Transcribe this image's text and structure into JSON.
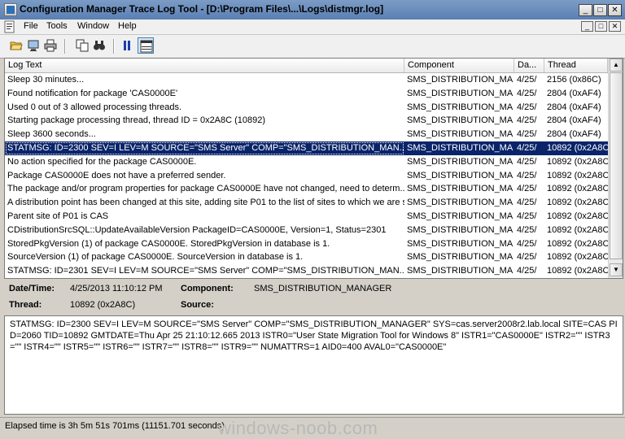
{
  "window": {
    "title": "Configuration Manager Trace Log Tool - [D:\\Program Files\\...\\Logs\\distmgr.log]",
    "min_glyph": "_",
    "max_glyph": "□",
    "close_glyph": "✕"
  },
  "menu": {
    "items": [
      "File",
      "Tools",
      "Window",
      "Help"
    ]
  },
  "grid": {
    "columns": [
      "Log Text",
      "Component",
      "Da...",
      "Thread"
    ],
    "rows": [
      {
        "text": "Sleep 30 minutes...",
        "component": "SMS_DISTRIBUTION_MA",
        "date": "4/25/",
        "thread": "2156 (0x86C)",
        "selected": false
      },
      {
        "text": "Found notification for package 'CAS0000E'",
        "component": "SMS_DISTRIBUTION_MA",
        "date": "4/25/",
        "thread": "2804 (0xAF4)",
        "selected": false
      },
      {
        "text": "Used 0 out of 3 allowed processing threads.",
        "component": "SMS_DISTRIBUTION_MA",
        "date": "4/25/",
        "thread": "2804 (0xAF4)",
        "selected": false
      },
      {
        "text": "Starting package processing thread, thread ID = 0x2A8C (10892)",
        "component": "SMS_DISTRIBUTION_MA",
        "date": "4/25/",
        "thread": "2804 (0xAF4)",
        "selected": false
      },
      {
        "text": "Sleep 3600 seconds...",
        "component": "SMS_DISTRIBUTION_MA",
        "date": "4/25/",
        "thread": "2804 (0xAF4)",
        "selected": false
      },
      {
        "text": "STATMSG: ID=2300 SEV=I LEV=M SOURCE=\"SMS Server\" COMP=\"SMS_DISTRIBUTION_MAN...",
        "component": "SMS_DISTRIBUTION_MA",
        "date": "4/25/",
        "thread": "10892 (0x2A8C)",
        "selected": true
      },
      {
        "text": "No action specified for the package CAS0000E.",
        "component": "SMS_DISTRIBUTION_MA",
        "date": "4/25/",
        "thread": "10892 (0x2A8C)",
        "selected": false
      },
      {
        "text": "Package CAS0000E does not have a preferred sender.",
        "component": "SMS_DISTRIBUTION_MA",
        "date": "4/25/",
        "thread": "10892 (0x2A8C)",
        "selected": false
      },
      {
        "text": "The package and/or program properties for package CAS0000E have not changed,  need to determ...",
        "component": "SMS_DISTRIBUTION_MA",
        "date": "4/25/",
        "thread": "10892 (0x2A8C)",
        "selected": false
      },
      {
        "text": "A distribution point has been changed at this site, adding site P01 to the list of sites to which we are s...",
        "component": "SMS_DISTRIBUTION_MA",
        "date": "4/25/",
        "thread": "10892 (0x2A8C)",
        "selected": false
      },
      {
        "text": "Parent site of P01 is CAS",
        "component": "SMS_DISTRIBUTION_MA",
        "date": "4/25/",
        "thread": "10892 (0x2A8C)",
        "selected": false
      },
      {
        "text": "CDistributionSrcSQL::UpdateAvailableVersion PackageID=CAS0000E, Version=1, Status=2301",
        "component": "SMS_DISTRIBUTION_MA",
        "date": "4/25/",
        "thread": "10892 (0x2A8C)",
        "selected": false
      },
      {
        "text": "StoredPkgVersion (1) of package CAS0000E. StoredPkgVersion in database is 1.",
        "component": "SMS_DISTRIBUTION_MA",
        "date": "4/25/",
        "thread": "10892 (0x2A8C)",
        "selected": false
      },
      {
        "text": "SourceVersion (1) of package CAS0000E. SourceVersion in database is 1.",
        "component": "SMS_DISTRIBUTION_MA",
        "date": "4/25/",
        "thread": "10892 (0x2A8C)",
        "selected": false
      },
      {
        "text": "STATMSG: ID=2301 SEV=I LEV=M SOURCE=\"SMS Server\" COMP=\"SMS_DISTRIBUTION_MAN...",
        "component": "SMS_DISTRIBUTION_MA",
        "date": "4/25/",
        "thread": "10892 (0x2A8C)",
        "selected": false
      }
    ],
    "scroll_up": "▲",
    "scroll_down": "▼"
  },
  "details": {
    "datetime_label": "Date/Time:",
    "datetime_value": "4/25/2013 11:10:12 PM",
    "component_label": "Component:",
    "component_value": "SMS_DISTRIBUTION_MANAGER",
    "thread_label": "Thread:",
    "thread_value": "10892 (0x2A8C)",
    "source_label": "Source:",
    "source_value": ""
  },
  "message": "STATMSG: ID=2300 SEV=I LEV=M SOURCE=\"SMS Server\" COMP=\"SMS_DISTRIBUTION_MANAGER\" SYS=cas.server2008r2.lab.local SITE=CAS PID=2060 TID=10892 GMTDATE=Thu Apr 25 21:10:12.665 2013 ISTR0=\"User State Migration Tool for Windows 8\" ISTR1=\"CAS0000E\" ISTR2=\"\" ISTR3=\"\" ISTR4=\"\" ISTR5=\"\" ISTR6=\"\" ISTR7=\"\" ISTR8=\"\" ISTR9=\"\" NUMATTRS=1 AID0=400 AVAL0=\"CAS0000E\"",
  "status": {
    "text": "Elapsed time is 3h 5m 51s 701ms (11151.701 seconds)",
    "watermark": "windows-noob.com"
  }
}
